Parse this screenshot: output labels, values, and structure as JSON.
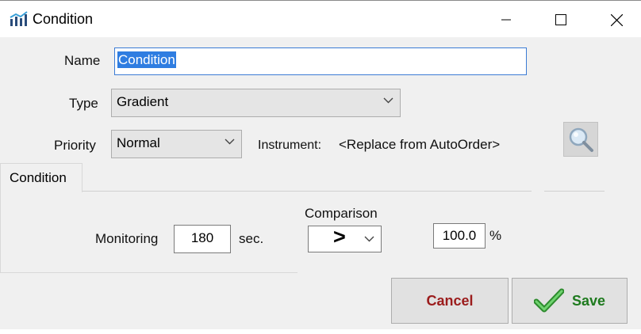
{
  "window": {
    "title": "Condition",
    "controls": {
      "minimize": "minimize",
      "maximize": "maximize",
      "close": "close"
    }
  },
  "form": {
    "name_label": "Name",
    "name_value": "Condition",
    "type_label": "Type",
    "type_value": "Gradient",
    "priority_label": "Priority",
    "priority_value": "Normal",
    "instrument_label": "Instrument:",
    "instrument_value": "<Replace from AutoOrder>"
  },
  "tabs": [
    {
      "label": "Condition",
      "active": true
    }
  ],
  "condition": {
    "monitoring_label": "Monitoring",
    "monitoring_value": "180",
    "monitoring_unit": "sec.",
    "comparison_label": "Comparison",
    "comparison_value": ">",
    "threshold_value": "100.0",
    "threshold_unit": "%"
  },
  "buttons": {
    "cancel": "Cancel",
    "save": "Save"
  },
  "icons": {
    "app": "bar-chart-trend-icon",
    "search": "magnifier-icon",
    "save": "checkmark-icon"
  },
  "colors": {
    "selection": "#2f7de1",
    "cancel_text": "#9b1c1c",
    "save_text": "#1e7a1e",
    "check_green": "#4caf50"
  }
}
